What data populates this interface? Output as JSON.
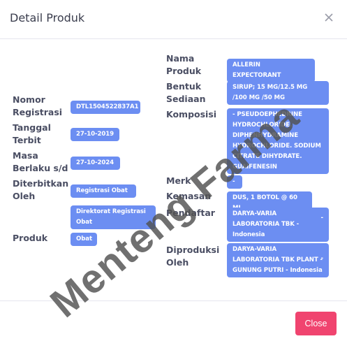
{
  "dialog": {
    "title": "Detail Produk",
    "close_icon": "close-icon",
    "close_button": "Close"
  },
  "left_fields": {
    "nomor_registrasi": {
      "label": "Nomor Registrasi",
      "value": "DTL1504522837A1"
    },
    "tanggal_terbit": {
      "label": "Tanggal Terbit",
      "value": "27-10-2019"
    },
    "masa_berlaku": {
      "label": "Masa Berlaku s/d",
      "value": "27-10-2024"
    },
    "diterbitkan_oleh": {
      "label": "Diterbitkan Oleh",
      "value": "Registrasi Obat",
      "value2": "Direktorat Registrasi Obat"
    },
    "produk": {
      "label": "Produk",
      "value": "Obat"
    }
  },
  "right_fields": {
    "nama_produk": {
      "label": "Nama Produk",
      "value": "ALLERIN EXPECTORANT"
    },
    "bentuk_sediaan": {
      "label": "Bentuk Sediaan",
      "value": "SIRUP; 15 MG/12.5 MG /100 MG /50 MG"
    },
    "komposisi": {
      "label": "Komposisi",
      "value": "- PSEUDOEPHEDRINE HYDROCHLORIDE. DIPHENHYDRAMINE HYDROCHLORIDE. SODIUM CITRATE DIHYDRATE. GUAIFENESIN"
    },
    "merk": {
      "label": "Merk",
      "value": "-"
    },
    "kemasan": {
      "label": "Kemasan",
      "value": "DUS, 1 BOTOL @ 60 ML"
    },
    "pendaftar": {
      "label": "Pendaftar",
      "value": "DARYA-VARIA LABORATORIA TBK - Indonesia",
      "dash": "-"
    },
    "diproduksi_oleh": {
      "label": "Diproduksi Oleh",
      "value": "DARYA-VARIA LABORATORIA TBK PLANT - GUNUNG PUTRI - Indonesia",
      "dash": "-"
    }
  },
  "watermark": "Menteng Farma",
  "colors": {
    "pill": "#6c8ef2",
    "close_button": "#f0446f",
    "label": "#4a4e63"
  }
}
